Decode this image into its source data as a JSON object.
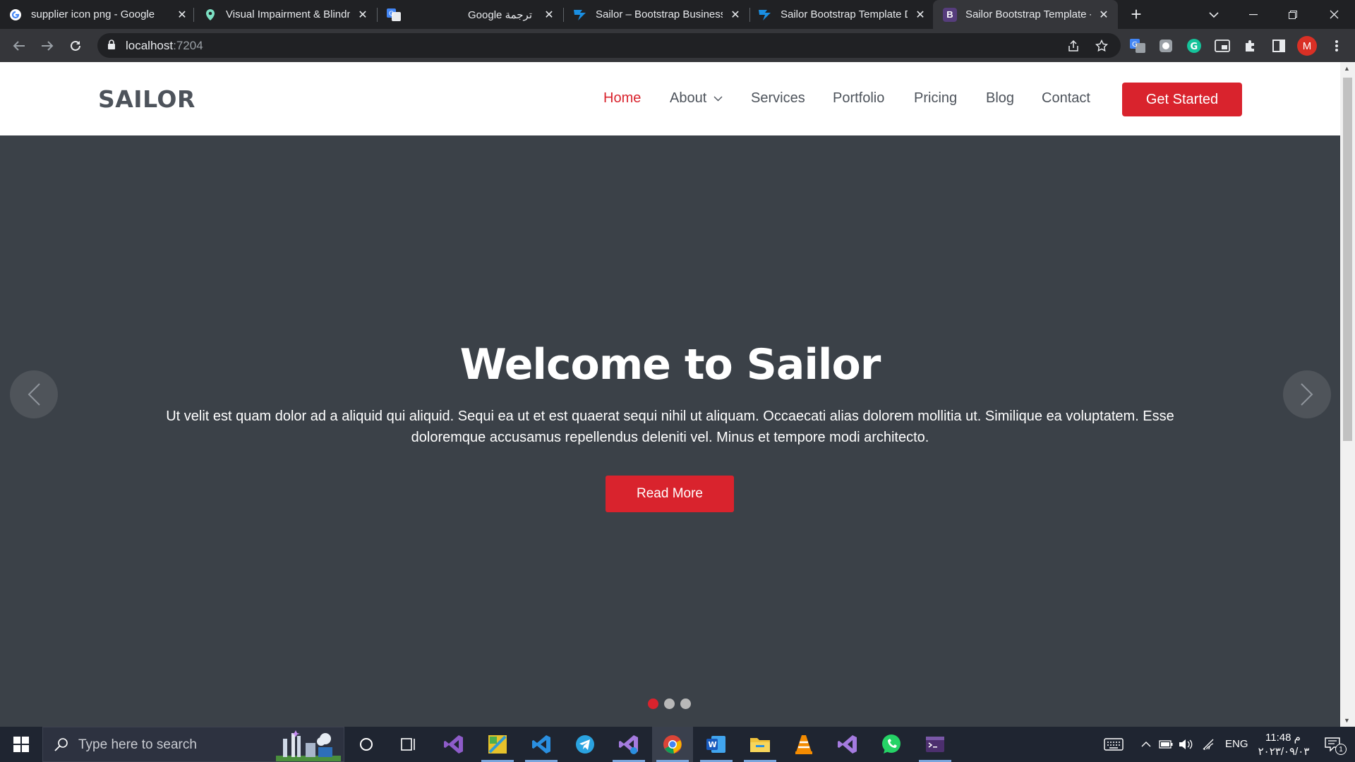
{
  "browser": {
    "tabs": [
      {
        "title": "supplier icon png - Google",
        "icon": "google-icon"
      },
      {
        "title": "Visual Impairment & Blindn",
        "icon": "map-pin-icon"
      },
      {
        "title": "Google ترجمة",
        "icon": "translate-icon"
      },
      {
        "title": "Sailor – Bootstrap Business",
        "icon": "sailor-icon"
      },
      {
        "title": "Sailor Bootstrap Template D",
        "icon": "sailor-icon"
      },
      {
        "title": "Sailor Bootstrap Template -",
        "icon": "bootstrap-icon"
      }
    ],
    "active_tab": 5,
    "url_host": "localhost",
    "url_port": ":7204",
    "profile_initial": "M"
  },
  "site": {
    "logo": "SAILOR",
    "nav": [
      {
        "label": "Home"
      },
      {
        "label": "About"
      },
      {
        "label": "Services"
      },
      {
        "label": "Portfolio"
      },
      {
        "label": "Pricing"
      },
      {
        "label": "Blog"
      },
      {
        "label": "Contact"
      }
    ],
    "cta_label": "Get Started"
  },
  "hero": {
    "title": "Welcome to Sailor",
    "text": "Ut velit est quam dolor ad a aliquid qui aliquid. Sequi ea ut et est quaerat sequi nihil ut aliquam. Occaecati alias dolorem mollitia ut. Similique ea voluptatem. Esse doloremque accusamus repellendus deleniti vel. Minus et tempore modi architecto.",
    "button_label": "Read More",
    "slides": 3,
    "active_slide": 0
  },
  "taskbar": {
    "search_placeholder": "Type here to search",
    "language": "ENG",
    "time": "11:48 م",
    "date": "٢٠٢٣/٠٩/٠٣",
    "notification_count": "1"
  },
  "colors": {
    "accent": "#d9232d",
    "hero_bg": "#3b4148",
    "text_dark": "#4d535b"
  }
}
